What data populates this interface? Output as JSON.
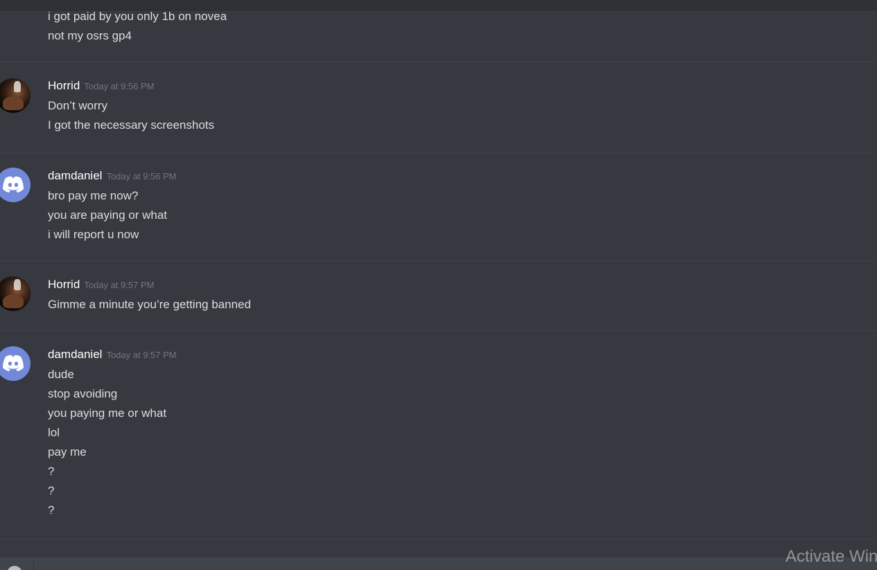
{
  "messages": [
    {
      "author": "",
      "timestamp": "",
      "avatar": "none",
      "lines": [
        "i got paid by you only 1b on novea",
        "not my osrs gp4"
      ]
    },
    {
      "author": "Horrid",
      "timestamp": "Today at 9:56 PM",
      "avatar": "photo",
      "lines": [
        "Don’t worry",
        "I got the necessary screenshots"
      ]
    },
    {
      "author": "damdaniel",
      "timestamp": "Today at 9:56 PM",
      "avatar": "discord-logo-icon",
      "lines": [
        "bro pay me now?",
        "you are paying or what",
        "i will report u now"
      ]
    },
    {
      "author": "Horrid",
      "timestamp": "Today at 9:57 PM",
      "avatar": "photo",
      "lines": [
        "Gimme a minute you’re getting banned"
      ]
    },
    {
      "author": "damdaniel",
      "timestamp": "Today at 9:57 PM",
      "avatar": "discord-logo-icon",
      "lines": [
        "dude",
        "stop avoiding",
        "you paying me or what",
        "lol",
        "pay me",
        "?",
        "?",
        "?"
      ]
    }
  ],
  "watermark": "Activate Win",
  "colors": {
    "background": "#36393f",
    "discord_blurple": "#7289da",
    "text": "#dcddde",
    "username": "#ffffff",
    "timestamp": "#72767d"
  }
}
